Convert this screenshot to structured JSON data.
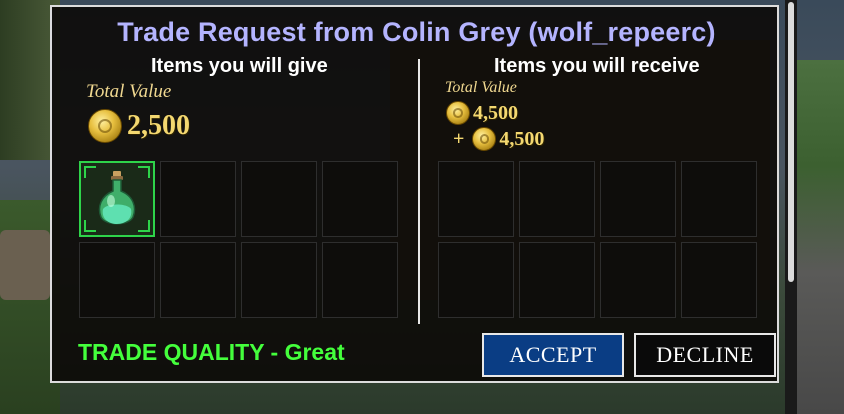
{
  "trade": {
    "title": "Trade Request from Colin Grey (wolf_repeerc)",
    "give": {
      "heading": "Items you will give",
      "total_label": "Total Value",
      "total_amount": "2,500",
      "slots": [
        {
          "item": "green-potion-icon",
          "filled": true
        },
        {
          "filled": false
        },
        {
          "filled": false
        },
        {
          "filled": false
        },
        {
          "filled": false
        },
        {
          "filled": false
        },
        {
          "filled": false
        },
        {
          "filled": false
        }
      ]
    },
    "receive": {
      "heading": "Items you will receive",
      "total_label": "Total Value",
      "amount_1": "4,500",
      "plus": "+",
      "amount_2": "4,500",
      "slots": [
        {
          "filled": false
        },
        {
          "filled": false
        },
        {
          "filled": false
        },
        {
          "filled": false
        },
        {
          "filled": false
        },
        {
          "filled": false
        },
        {
          "filled": false
        },
        {
          "filled": false
        }
      ]
    },
    "quality_text": "TRADE QUALITY - Great",
    "accept_label": "ACCEPT",
    "decline_label": "DECLINE"
  },
  "colors": {
    "title": "#b4b4ff",
    "quality": "#44ff3c",
    "accept_bg": "#0a3d84",
    "coin": "#e8c040",
    "item_border": "#2ed44a"
  }
}
